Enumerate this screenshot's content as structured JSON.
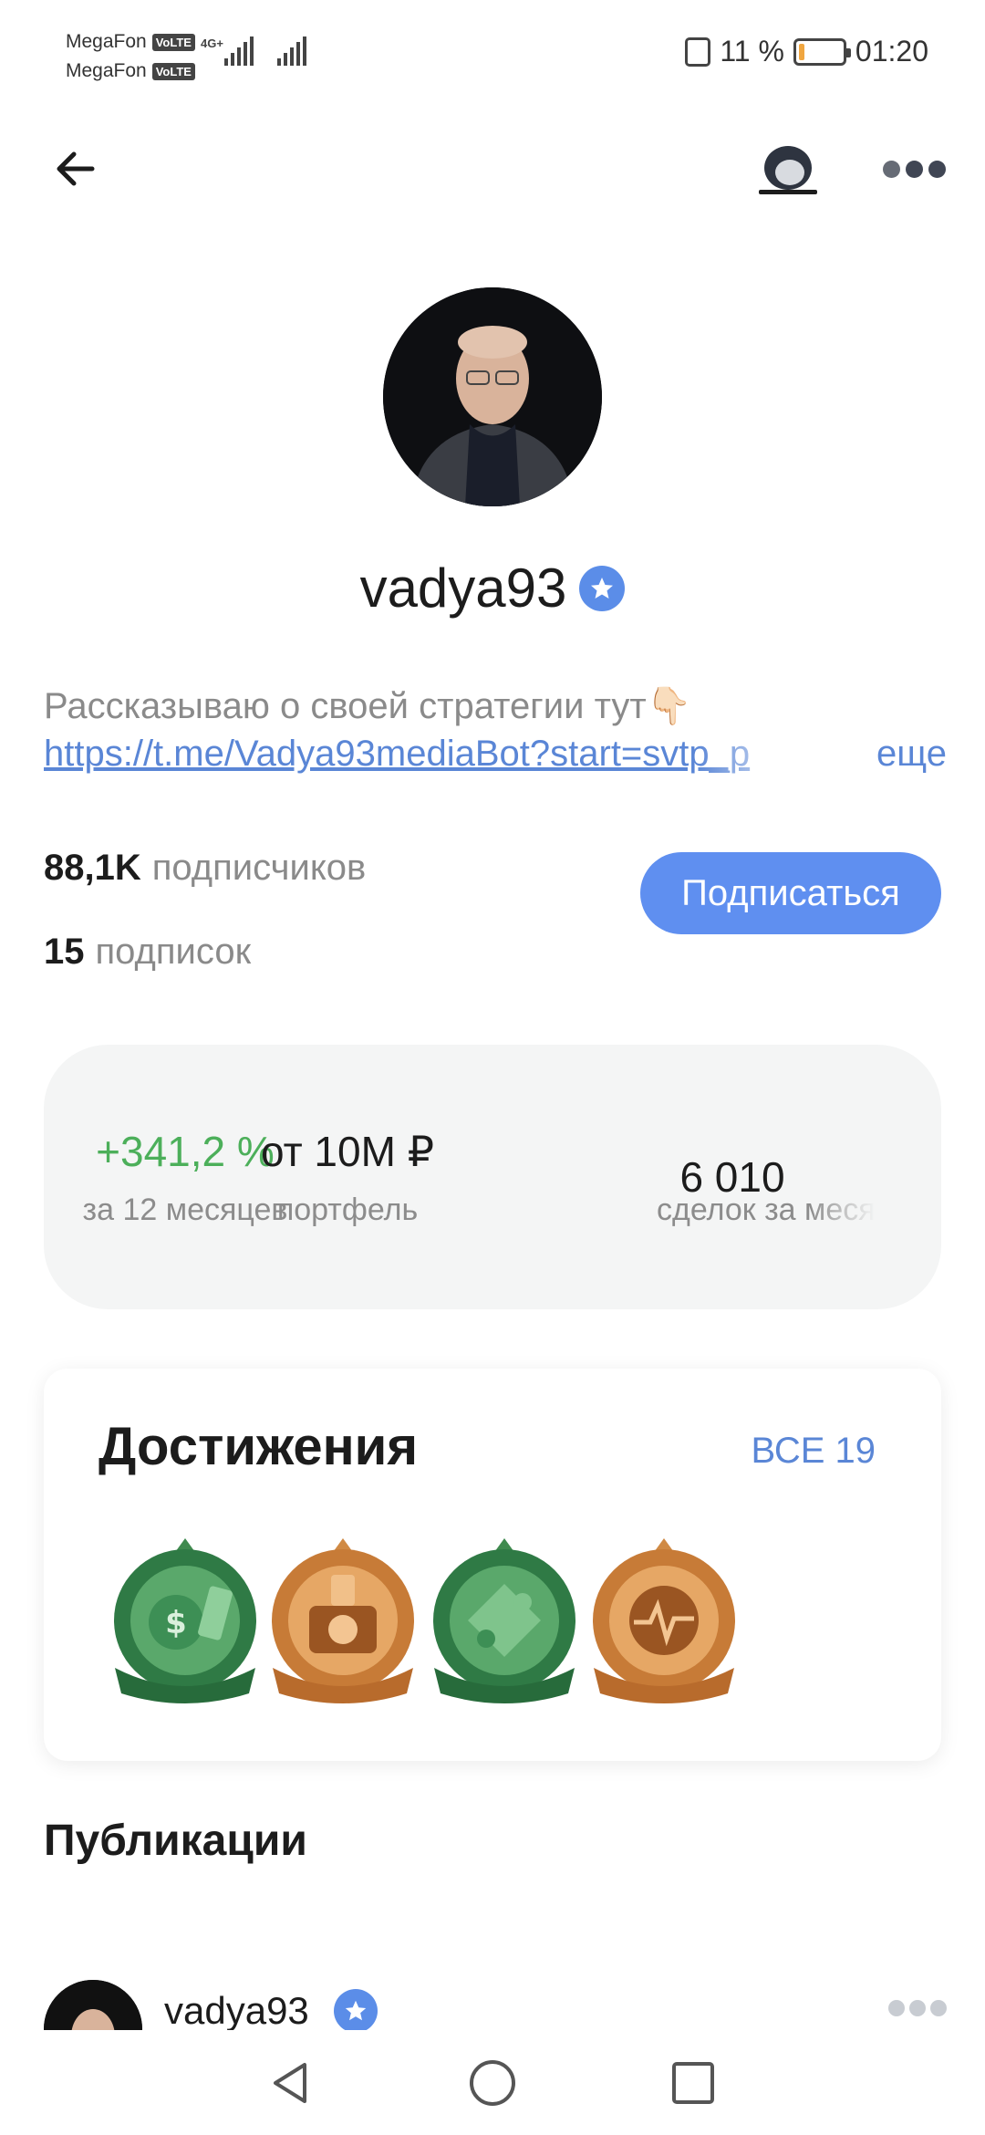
{
  "status_bar": {
    "carrier1": "MegaFon",
    "carrier2": "MegaFon",
    "volte": "VoLTE",
    "network": "4G+",
    "battery_percent": "11 %",
    "battery_level": 0.11,
    "time": "01:20"
  },
  "top_bar": {
    "back_icon": "arrow-left-icon",
    "more_icon": "more-dots-icon"
  },
  "profile": {
    "username": "vadya93",
    "verified_icon": "verified-star-icon",
    "bio_text": "Рассказываю о своей стратегии тут👇🏻",
    "bio_link": "https://t.me/Vadya93mediaBot?start=svtp_p",
    "bio_more": "еще",
    "followers_count": "88,1K",
    "followers_label": "подписчиков",
    "following_count": "15",
    "following_label": "подписок",
    "subscribe_label": "Подписаться"
  },
  "stats": [
    {
      "value": "+341,2 %",
      "label": "за 12 месяцев"
    },
    {
      "value": "от 10M ₽",
      "label": "портфель"
    },
    {
      "value": "6 010",
      "label": "сделок за меся"
    }
  ],
  "achievements": {
    "title": "Достижения",
    "all_label": "ВСЕ 19",
    "badges": [
      "money-badge-icon",
      "camera-badge-icon",
      "puzzle-badge-icon",
      "pulse-badge-icon"
    ]
  },
  "publications": {
    "title": "Публикации",
    "author": "vadya93"
  },
  "colors": {
    "accent": "#5f8ff0",
    "link": "#5a86d6",
    "positive": "#4caf5a",
    "card_bg": "#f4f5f5"
  }
}
